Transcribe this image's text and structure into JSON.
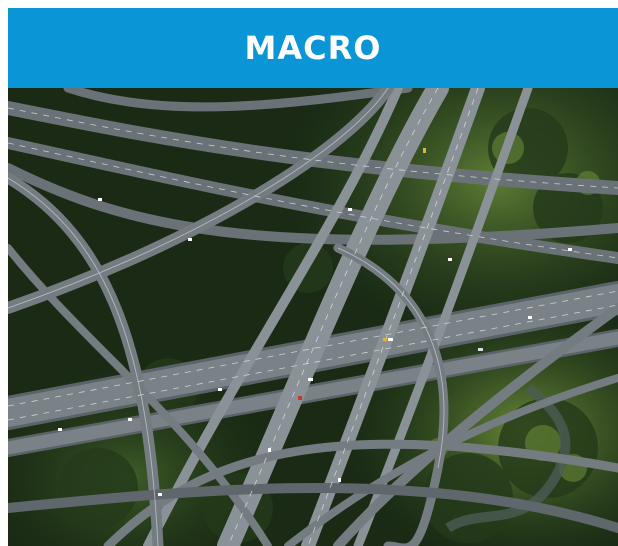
{
  "banner": {
    "title": "MACRO",
    "color": "#0a95d6"
  },
  "photo": {
    "subject": "aerial-highway-interchange-icon",
    "colors": {
      "vegetation_dark": "#13220f",
      "vegetation_mid": "#2c4a1f",
      "vegetation_light": "#5f7d35",
      "road": "#6c7378",
      "road_light": "#8f979c",
      "lane_mark": "#e7ecef",
      "water": "#4c5b55"
    }
  }
}
